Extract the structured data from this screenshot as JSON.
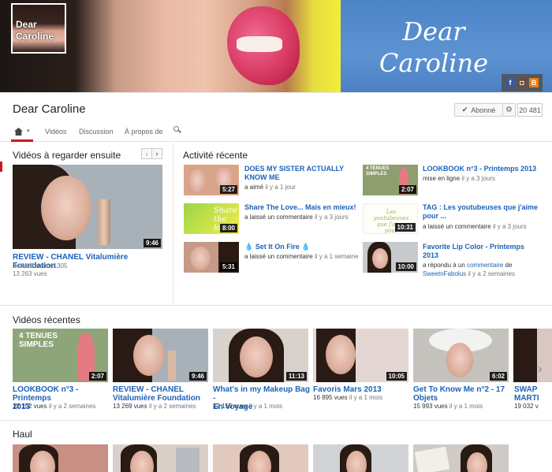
{
  "banner": {
    "title": "Dear Caroline",
    "avatar_text": "Dear Caroline",
    "social_icons": [
      "facebook-icon",
      "instagram-icon",
      "blogger-icon"
    ]
  },
  "channel": {
    "name": "Dear Caroline",
    "subscribe_label": "Abonné",
    "subscriber_count": "20 481"
  },
  "tabs": [
    {
      "label": "Vidéos"
    },
    {
      "label": "Discussion"
    },
    {
      "label": "À propos de"
    }
  ],
  "watch_next": {
    "title": "Vidéos à regarder ensuite",
    "video": {
      "title": "REVIEW - CHANEL Vitalumière Foundation",
      "duration": "9:46",
      "by_prefix": "de",
      "author": "MsCaroline1305",
      "views": "13 263 vues"
    }
  },
  "activity": {
    "title": "Activité récente",
    "items": [
      {
        "title_line1": "DOES MY SISTER ACTUALLY",
        "title_line2": "KNOW ME",
        "duration": "5:27",
        "action": "a aimé",
        "ago": "il y a 1 jour"
      },
      {
        "title_line1": "Share The Love... Mais en mieux!",
        "title_line2": "",
        "duration": "8:00",
        "action": "a laissé un commentaire",
        "ago": "il y a 3 jours"
      },
      {
        "title_line1": "💧 Set It On Fire 💧",
        "title_line2": "",
        "duration": "5:31",
        "action": "a laissé un commentaire",
        "ago": "il y a 1 semaine"
      },
      {
        "title_line1": "LOOKBOOK n°3 - Printemps 2013",
        "title_line2": "",
        "duration": "2:07",
        "action": "mise en ligne",
        "ago": "il y a 3 jours"
      },
      {
        "title_line1": "TAG : Les youtubeuses que j'aime",
        "title_line2": "pour ...",
        "duration": "10:31",
        "action": "a laissé un commentaire",
        "ago": "il y a 3 jours"
      },
      {
        "title_line1": "Favorite Lip Color - Printemps",
        "title_line2": "2013",
        "duration": "10:00",
        "action": "a répondu à un",
        "action_link": "commentaire",
        "action_suffix": "de",
        "user": "SweetnFabolus",
        "ago": "il y a 2 semaines"
      }
    ]
  },
  "recent": {
    "title": "Vidéos récentes",
    "videos": [
      {
        "title_line1": "LOOKBOOK n°3 - Printemps",
        "title_line2": "2013",
        "duration": "2:07",
        "views": "12 152 vues",
        "ago": "il y a 2 semaines"
      },
      {
        "title_line1": "REVIEW - CHANEL",
        "title_line2": "Vitalumière Foundation",
        "duration": "9:46",
        "views": "13 269 vues",
        "ago": "il y a 2 semaines"
      },
      {
        "title_line1": "What's in my Makeup Bag -",
        "title_line2": "En Voyage",
        "duration": "11:13",
        "views": "12 155 vues",
        "ago": "il y a 1 mois"
      },
      {
        "title_line1": "Favoris Mars 2013",
        "title_line2": "",
        "duration": "10:05",
        "views": "16 895 vues",
        "ago": "il y a 1 mois"
      },
      {
        "title_line1": "Get To Know Me n°2 - 17",
        "title_line2": "Objets",
        "duration": "6:02",
        "views": "15 993 vues",
        "ago": "il y a 1 mois"
      },
      {
        "title_line1": "SWAP",
        "title_line2": "MARTI",
        "duration": "",
        "views": "19 032 v",
        "ago": ""
      }
    ]
  },
  "haul": {
    "title": "Haul"
  },
  "thumb_overlay_text": {
    "lookbook": "4 TENUES SIMPLES",
    "share": "Share the love",
    "tag": "Les youtubeuses que j'aime pour"
  }
}
